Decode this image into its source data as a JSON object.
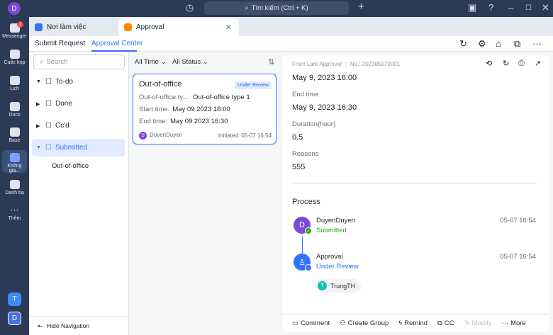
{
  "titlebar": {
    "avatar_letter": "D",
    "search_placeholder": "Tìm kiếm (Ctrl + K)",
    "icons": [
      "history-icon",
      "search-icon",
      "plus-icon",
      "calendar-check-icon",
      "help-icon",
      "minimize-icon",
      "maximize-icon",
      "close-icon"
    ]
  },
  "leftnav": {
    "items": [
      {
        "label": "Messenger",
        "badge": "1"
      },
      {
        "label": "Cuộc họp"
      },
      {
        "label": "Lịch"
      },
      {
        "label": "Docs"
      },
      {
        "label": "Base"
      },
      {
        "label": "Không gia..."
      },
      {
        "label": "Danh bạ"
      },
      {
        "label": "Thêm"
      }
    ],
    "bottom_avatars": [
      "T",
      "D"
    ]
  },
  "tabs": {
    "workspace": "Nơi làm việc",
    "approval": "Approval"
  },
  "appheader": {
    "submit_request": "Submit Request",
    "approval_center": "Approval Center"
  },
  "sidebar": {
    "search_placeholder": "Search",
    "items": [
      {
        "label": "To-do"
      },
      {
        "label": "Done"
      },
      {
        "label": "Cc'd"
      },
      {
        "label": "Submitted"
      }
    ],
    "sub_item": "Out-of-office",
    "hide_navigation": "Hide Navigation"
  },
  "list": {
    "filter_time": "All Time",
    "filter_status": "All Status",
    "card": {
      "title": "Out-of-office",
      "status": "Under Review",
      "type_key": "Out-of-office ty...:",
      "type_value": "Out-of-office type 1",
      "start_key": "Start time:",
      "start_value": "May 09 2023 16:00",
      "end_key": "End time:",
      "end_value": "May 09 2023 16:30",
      "user_initial": "D",
      "user": "DuyenDuyen",
      "initiated": "Initiated: 05-07 16:54"
    }
  },
  "detail": {
    "source": "From Lark Approval",
    "number": "No.: 202305070001",
    "start_value": "May 9, 2023 16:00",
    "end_label": "End time",
    "end_value": "May 9, 2023 16:30",
    "duration_label": "Duration(hour)",
    "duration_value": "0.5",
    "reasons_label": "Reasons",
    "reasons_value": "555",
    "process_title": "Process",
    "steps": [
      {
        "initial": "D",
        "name": "DuyenDuyen",
        "status": "Submitted",
        "time": "05-07 16:54"
      },
      {
        "name": "Approval",
        "status": "Under Review",
        "time": "05-07 16:54"
      }
    ],
    "approver_initial": "T",
    "approver": "TrungTH",
    "actions": {
      "comment": "Comment",
      "create_group": "Create Group",
      "remind": "Remind",
      "cc": "CC",
      "modify": "Modify",
      "more": "More"
    }
  },
  "colors": {
    "accent": "#3370ff",
    "submitted": "#2ea121",
    "under_review": "#3370ff",
    "nav_bg": "#2b3a55"
  }
}
